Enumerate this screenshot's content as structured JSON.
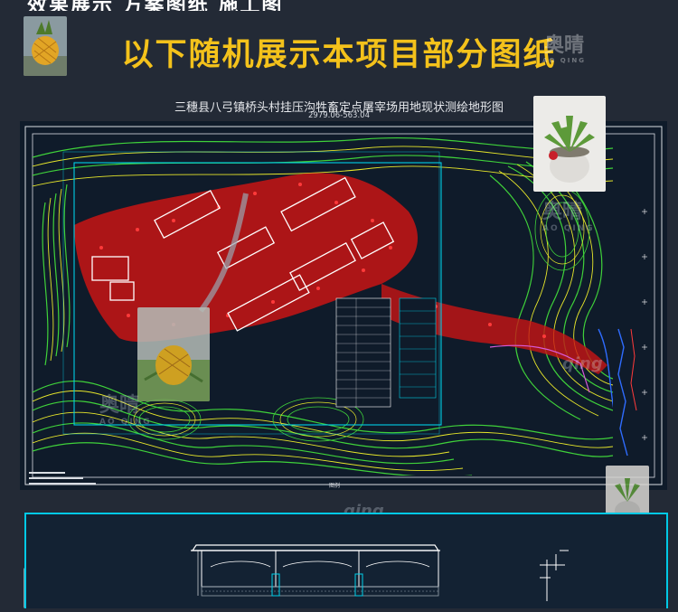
{
  "page": {
    "headline": "以下随机展示本项目部分图纸",
    "top_strip_text": "效果展示   方案图纸   施工图",
    "brand": {
      "cn": "奥晴",
      "en": "AO QING"
    }
  },
  "drawing": {
    "title": "三穗县八弓镇桥头村挂压沟牲畜定点屠宰场用地现状测绘地形图",
    "subtitle": "2979.06-563.04",
    "legend_center": "图例"
  },
  "watermarks": {
    "brand_cn": "奥晴",
    "brand_en": "AO QING",
    "script_mark": "qing"
  },
  "thumbnails": [
    {
      "name": "pineapple-thumbnail"
    },
    {
      "name": "succulent-plant-thumbnail"
    },
    {
      "name": "fruit-thumbnail"
    },
    {
      "name": "small-plant-thumbnail"
    }
  ],
  "colors": {
    "background": "#232a36",
    "headline": "#f4c21b",
    "contour_green": "#3fd13a",
    "contour_yellow": "#e6e62a",
    "survey_red": "#ff1a1a",
    "boundary_cyan": "#00d0e8",
    "cad_background": "#0f1b2a"
  }
}
